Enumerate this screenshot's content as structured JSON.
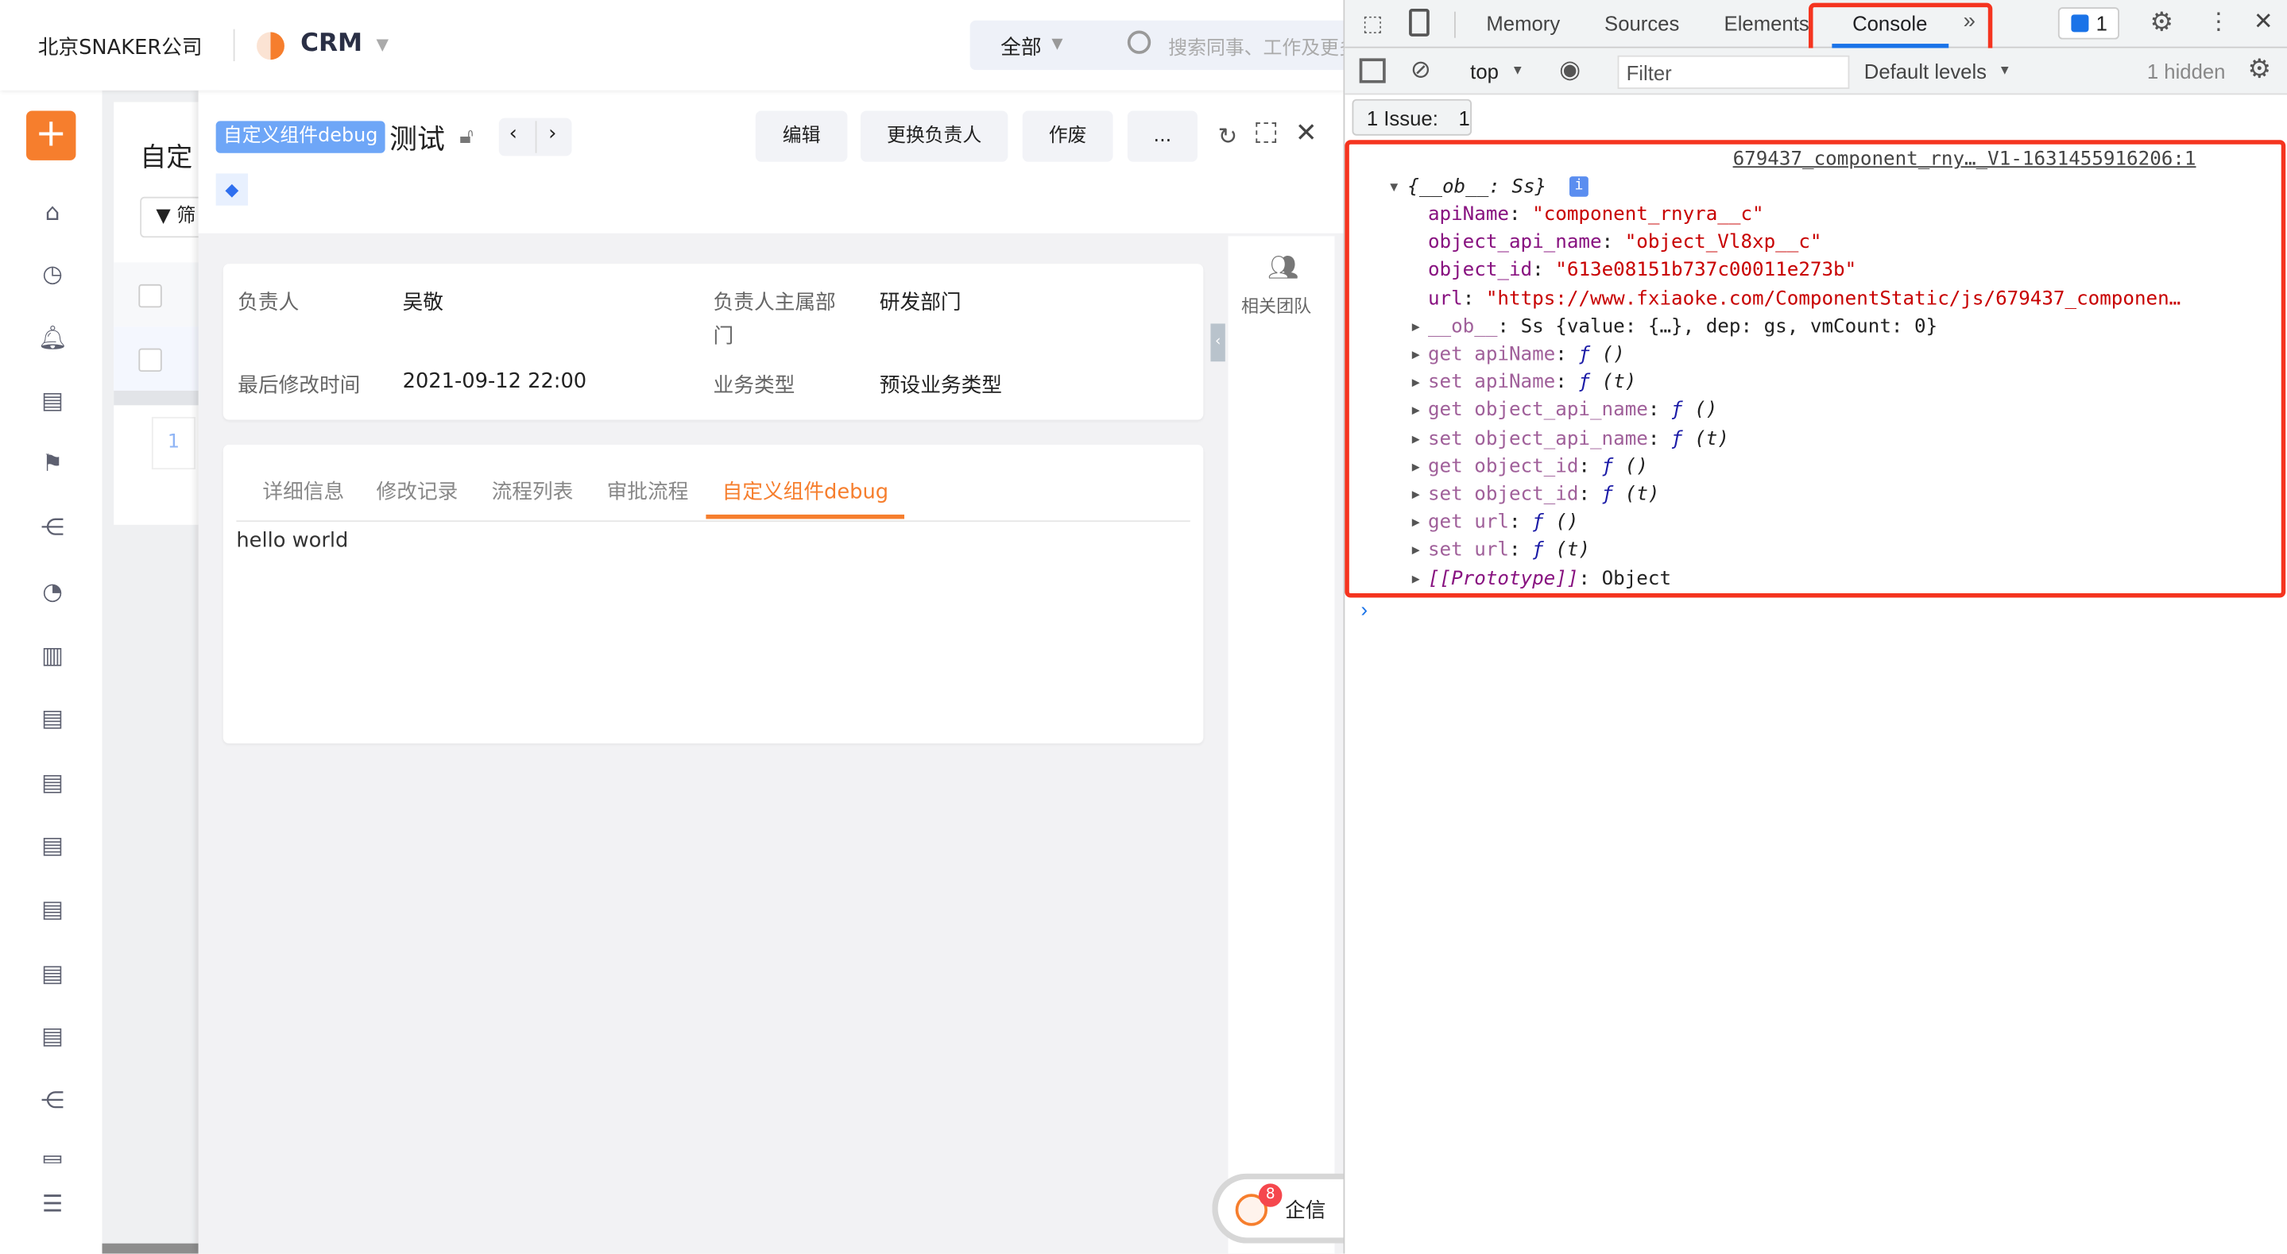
{
  "topbar": {
    "company": "北京SNAKER公司",
    "app_name": "CRM",
    "search_scope": "全部",
    "search_placeholder": "搜索同事、工作及更多"
  },
  "sidebar": {
    "icons": [
      "plus-icon",
      "home-icon",
      "clock-icon",
      "bell-icon",
      "folder-icon",
      "flag-icon",
      "org-icon",
      "pie-chart-icon",
      "dashboard-icon",
      "folder-icon",
      "folder-icon",
      "folder-icon",
      "folder-icon",
      "folder-icon",
      "folder-icon",
      "org-icon",
      "folder-icon",
      "collapse-menu-icon"
    ]
  },
  "list": {
    "title": "自定",
    "filter": "筛",
    "page": "1"
  },
  "detail": {
    "tag": "自定义组件debug",
    "title": "测试",
    "buttons": {
      "edit": "编辑",
      "change_owner": "更换负责人",
      "void": "作废",
      "more": "..."
    },
    "fields": [
      {
        "label": "负责人",
        "value": "吴敬"
      },
      {
        "label": "负责人主属部门",
        "value": "研发部门"
      },
      {
        "label": "最后修改时间",
        "value": "2021-09-12 22:00"
      },
      {
        "label": "业务类型",
        "value": "预设业务类型"
      }
    ],
    "tabs": [
      "详细信息",
      "修改记录",
      "流程列表",
      "审批流程",
      "自定义组件debug"
    ],
    "active_tab": "自定义组件debug",
    "tab_content": "hello world",
    "side_rail": {
      "team": "相关团队"
    },
    "chat": {
      "label": "企信",
      "badge": "8"
    },
    "accent": "#f67e2d",
    "tag_color": "#6ea6f7"
  },
  "devtools": {
    "tabs": [
      "Memory",
      "Sources",
      "Elements",
      "Console"
    ],
    "active_tab": "Console",
    "issues_badge": "1",
    "context": "top",
    "filter_placeholder": "Filter",
    "levels": "Default levels",
    "hidden": "1 hidden",
    "issue_bar": {
      "label": "1 Issue:",
      "count": "1"
    },
    "source_link": "679437_component_rny…_V1-1631455916206:1",
    "object_summary": "{__ob__: Ss}",
    "props": [
      {
        "key": "apiName",
        "value": "\"component_rnyra__c\""
      },
      {
        "key": "object_api_name",
        "value": "\"object_Vl8xp__c\""
      },
      {
        "key": "object_id",
        "value": "\"613e08151b737c00011e273b\""
      },
      {
        "key": "url",
        "value": "\"https://www.fxiaoke.com/ComponentStatic/js/679437_componen…"
      }
    ],
    "ob_line": {
      "key": "__ob__",
      "value": "Ss {value: {…}, dep: gs, vmCount: 0}"
    },
    "accessors": [
      {
        "key": "get apiName",
        "sig": "()"
      },
      {
        "key": "set apiName",
        "sig": "(t)"
      },
      {
        "key": "get object_api_name",
        "sig": "()"
      },
      {
        "key": "set object_api_name",
        "sig": "(t)"
      },
      {
        "key": "get object_id",
        "sig": "()"
      },
      {
        "key": "set object_id",
        "sig": "(t)"
      },
      {
        "key": "get url",
        "sig": "()"
      },
      {
        "key": "set url",
        "sig": "(t)"
      }
    ],
    "prototype": {
      "key": "[[Prototype]]",
      "value": "Object"
    },
    "highlight_color": "#f5341f"
  }
}
